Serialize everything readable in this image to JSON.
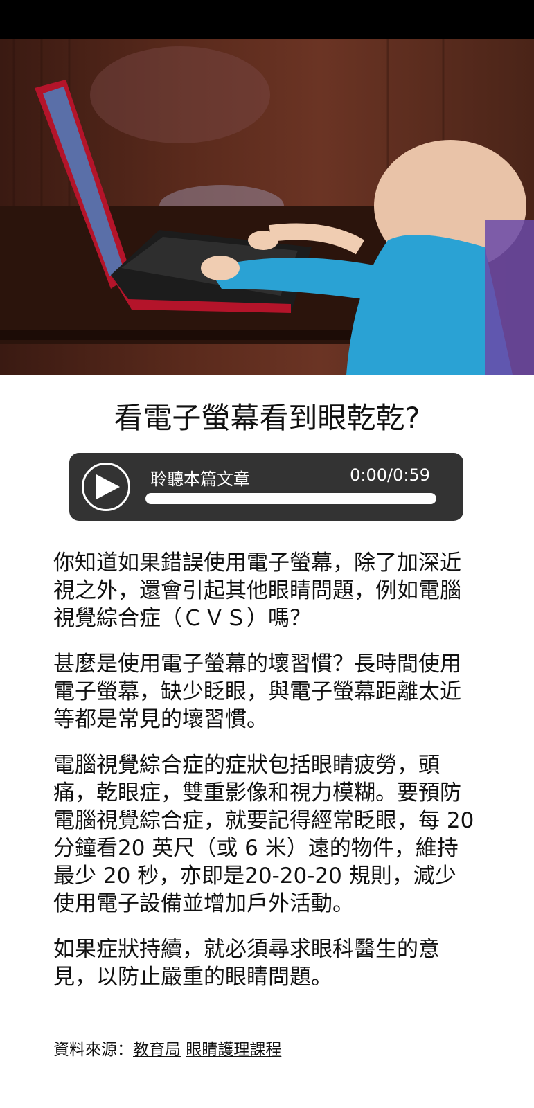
{
  "hero_image": {
    "icon": "child-using-laptop-photo"
  },
  "article": {
    "title": "看電子螢幕看到眼乾乾?",
    "paragraphs": [
      "你知道如果錯誤使用電子螢幕，除了加深近視之外，還會引起其他眼睛問題，例如電腦視覺綜合症（ＣＶＳ）嗎？",
      "甚麼是使用電子螢幕的壞習慣？長時間使用電子螢幕，缺少眨眼，與電子螢幕距離太近等都是常見的壞習慣。",
      "電腦視覺綜合症的症狀包括眼睛疲勞，頭痛，乾眼症，雙重影像和視力模糊。要預防電腦視覺綜合症，就要記得經常眨眼，每 20 分鐘看20 英尺（或 6 米）遠的物件，維持最少 20 秒，亦即是20-20-20 規則，減少使用電子設備並增加戶外活動。",
      "如果症狀持續，就必須尋求眼科醫生的意見，以防止嚴重的眼睛問題。"
    ]
  },
  "audio_player": {
    "label": "聆聽本篇文章",
    "time": "0:00/0:59",
    "progress": 0,
    "play_icon": "play-icon"
  },
  "source": {
    "prefix": "資料來源：",
    "link1": "教育局",
    "link2": "眼睛護理課程"
  },
  "colors": {
    "player_bg": "#333333",
    "status_bar": "#000000"
  }
}
